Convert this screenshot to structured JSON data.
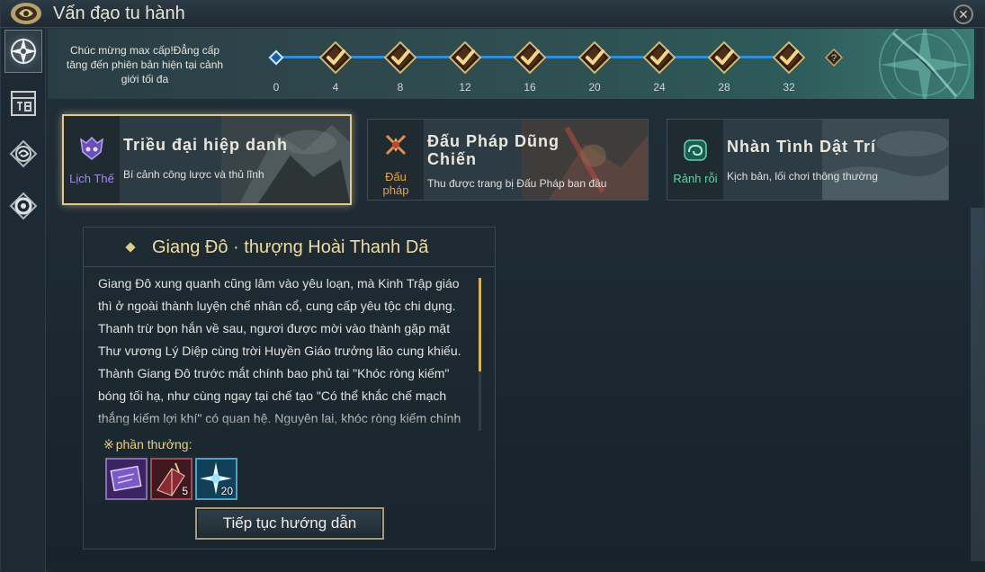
{
  "window": {
    "title": "Vấn đạo tu hành",
    "close_symbol": "✕"
  },
  "progress": {
    "message": "Chúc mừng max cấp!Đẳng cấp tăng đến phiên bản hiện tại cảnh giới tối đa",
    "current_level": 32,
    "nodes": [
      "0",
      "4",
      "8",
      "12",
      "16",
      "20",
      "24",
      "28",
      "32"
    ],
    "next_node_symbol": "?"
  },
  "modes": [
    {
      "tag": "Lịch Thế",
      "title": "Triều đại hiệp danh",
      "desc": "Bí cảnh công lược và thủ lĩnh",
      "tag_color": "#a58ce8",
      "selected": true
    },
    {
      "tag": "Đấu pháp",
      "title": "Đấu Pháp Dũng Chiến",
      "desc": "Thu được trang bị Đấu Pháp ban đầu",
      "tag_color": "#e9a24a",
      "selected": false
    },
    {
      "tag": "Rảnh rỗi",
      "title": "Nhàn Tình Dật Trí",
      "desc": "Kịch bản,  lối chơi thông thường",
      "tag_color": "#62d2a8",
      "selected": false
    }
  ],
  "story": {
    "title": "Giang Đô · thượng Hoài Thanh Dã",
    "text": "Giang Đô xung quanh cũng lâm vào yêu loạn, mà Kinh Trập giáo thì ở ngoài thành luyện chế nhân cổ, cung cấp yêu tộc chi dụng. Thanh trừ bọn hắn về sau, ngươi được mời vào thành gặp mặt Thư vương Lý Diệp cùng trời Huyền Giáo trưởng lão cung khiếu. Thành Giang Đô trước mắt chính bao phủ tại \"Khóc ròng kiếm\" bóng tối hạ, như cùng ngay tại chế tạo \"Có thể khắc chế mạch thắng kiếm lợi khí\" có quan hệ. Nguyên lai, khóc ròng kiếm chính là kiếm gãy",
    "reward_label": "phần thưởng:",
    "reward_mark": "※",
    "rewards": [
      {
        "icon": "treasure-scroll-icon",
        "qty": ""
      },
      {
        "icon": "book-icon",
        "qty": "5"
      },
      {
        "icon": "star-burst-icon",
        "qty": "20"
      }
    ],
    "continue_label": "Tiếp tục hướng dẫn"
  },
  "sidenav": [
    "compass-icon",
    "calendar-icon",
    "swirl-icon",
    "ring-icon"
  ]
}
